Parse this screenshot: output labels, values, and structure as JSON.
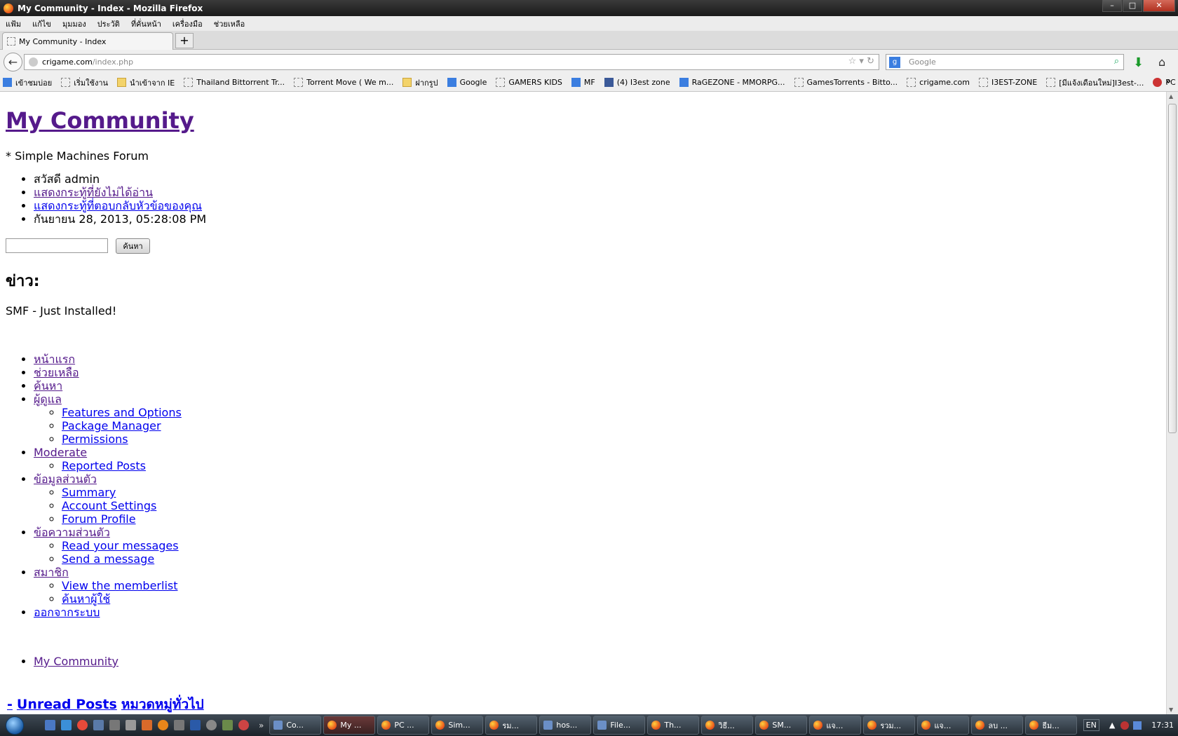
{
  "window": {
    "title": "My Community - Index - Mozilla Firefox",
    "controls": [
      "–",
      "□",
      "✕"
    ]
  },
  "menubar": [
    "แฟ้ม",
    "แก้ไข",
    "มุมมอง",
    "ประวัติ",
    "ที่คั่นหน้า",
    "เครื่องมือ",
    "ช่วยเหลือ"
  ],
  "tab": {
    "title": "My Community - Index",
    "new_tab": "+"
  },
  "nav": {
    "url_host": "crigame.com",
    "url_path": "/index.php",
    "search_placeholder": "Google"
  },
  "bookmarks": [
    "เข้าชมบ่อย",
    "เริ่มใช้งาน",
    "นำเข้าจาก IE",
    "Thailand Bittorrent Tr...",
    "Torrent Move ( We m...",
    "ฝากรูป",
    "Google",
    "GAMERS KIDS",
    "MF",
    "(4) I3est zone",
    "RaGEZONE - MMORPG...",
    "GamesTorrents - Bitto...",
    "crigame.com",
    "I3EST-ZONE",
    "[มีแจ้งเดือนใหม่]I3est-...",
    "PC Game - Download"
  ],
  "bookmarks_more": "»",
  "page": {
    "site_title": "My Community",
    "slogan": "* Simple Machines Forum",
    "user_info": {
      "greeting": "สวัสดี admin",
      "unread": "แสดงกระทู้ที่ยังไม่ได้อ่าน",
      "replies": "แสดงกระทู้ที่ตอบกลับหัวข้อของคุณ",
      "datetime": "กันยายน 28, 2013, 05:28:08 PM"
    },
    "search_button": "ค้นหา",
    "news_heading": "ข่าว:",
    "news_text": "SMF - Just Installed!",
    "menu": {
      "home": "หน้าแรก",
      "help": "ช่วยเหลือ",
      "search": "ค้นหา",
      "admin": "ผู้ดูแล",
      "admin_sub": [
        "Features and Options",
        "Package Manager",
        "Permissions"
      ],
      "moderate": "Moderate",
      "moderate_sub": [
        "Reported Posts"
      ],
      "profile": "ข้อมูลส่วนตัว",
      "profile_sub": [
        "Summary",
        "Account Settings",
        "Forum Profile"
      ],
      "pm": "ข้อความส่วนตัว",
      "pm_sub": [
        "Read your messages",
        "Send a message"
      ],
      "members": "สมาชิก",
      "members_sub": [
        "View the memberlist",
        "ค้นหาผู้ใช้"
      ],
      "logout": "ออกจากระบบ"
    },
    "linktree": "My Community",
    "bottom": {
      "dash": "-",
      "unread": "Unread Posts",
      "category": "หมวดหมู่ทั่วไป"
    }
  },
  "taskbar": {
    "quick_more": "»",
    "tasks": [
      "Co...",
      "My ...",
      "PC ...",
      "Sim...",
      "รม...",
      "hos...",
      "File...",
      "Th...",
      "วิธี...",
      "SM...",
      "แจ...",
      "รวม...",
      "แจ...",
      "ลบ ...",
      "ธีม..."
    ],
    "lang": "EN",
    "clock": "17:31"
  }
}
